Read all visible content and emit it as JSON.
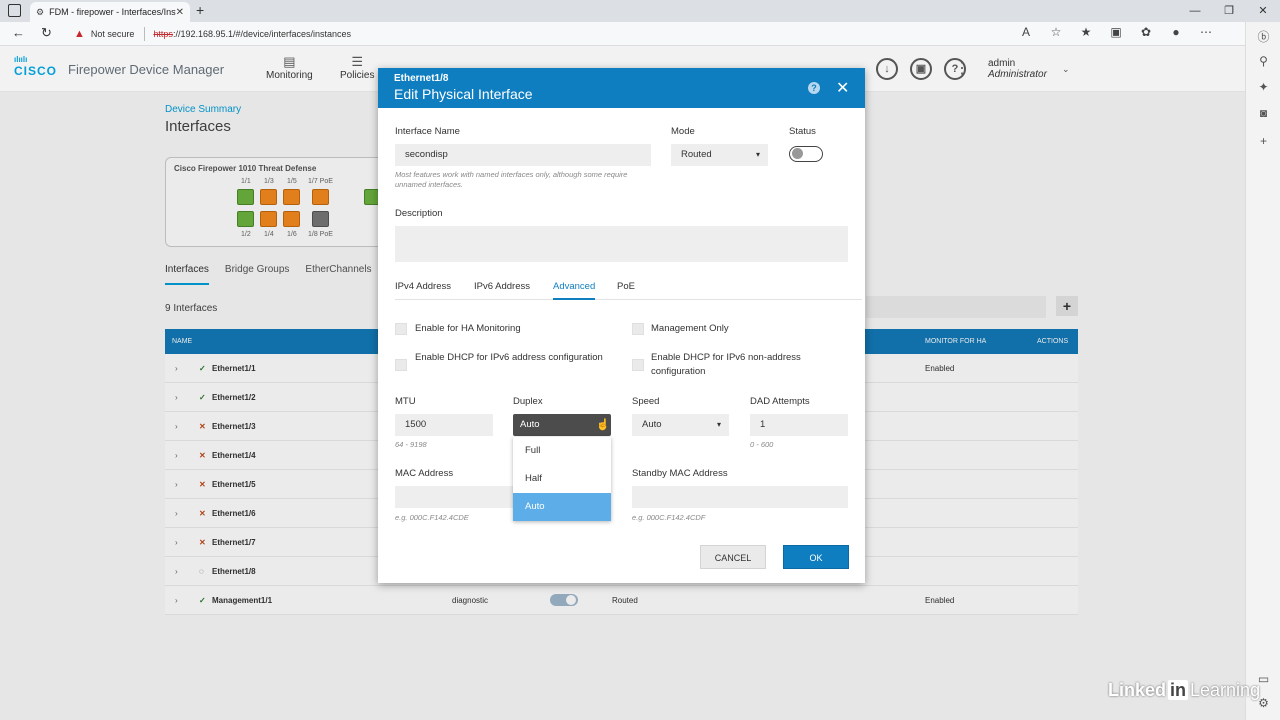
{
  "browser": {
    "tab_title": "FDM - firepower - Interfaces/Inst",
    "not_secure": "Not secure",
    "url_scheme": "https",
    "url_rest": "://192.168.95.1/#/device/interfaces/instances"
  },
  "app": {
    "brand": "CISCO",
    "title": "Firepower Device Manager",
    "nav": [
      {
        "label": "Monitoring",
        "icon": "monitor-icon"
      },
      {
        "label": "Policies",
        "icon": "policies-icon"
      }
    ],
    "user_name": "admin",
    "user_role": "Administrator"
  },
  "page": {
    "breadcrumb": "Device Summary",
    "title": "Interfaces",
    "device_name": "Cisco Firepower 1010 Threat Defense",
    "port_labels_top": [
      "1/1",
      "1/3",
      "1/5",
      "1/7 PoE"
    ],
    "port_labels_bottom": [
      "1/2",
      "1/4",
      "1/6",
      "1/8 PoE"
    ],
    "subtabs": [
      "Interfaces",
      "Bridge Groups",
      "EtherChannels"
    ],
    "count": "9 Interfaces",
    "table_headers": {
      "name": "NAME",
      "monitor": "MONITOR FOR HA",
      "actions": "ACTIONS"
    },
    "rows": [
      {
        "name": "Ethernet1/1",
        "status": "ok",
        "monitor": "Enabled"
      },
      {
        "name": "Ethernet1/2",
        "status": "ok",
        "monitor": ""
      },
      {
        "name": "Ethernet1/3",
        "status": "bad",
        "monitor": ""
      },
      {
        "name": "Ethernet1/4",
        "status": "bad",
        "monitor": ""
      },
      {
        "name": "Ethernet1/5",
        "status": "bad",
        "monitor": ""
      },
      {
        "name": "Ethernet1/6",
        "status": "bad",
        "monitor": ""
      },
      {
        "name": "Ethernet1/7",
        "status": "bad",
        "monitor": ""
      },
      {
        "name": "Ethernet1/8",
        "status": "mid",
        "monitor": ""
      },
      {
        "name": "Management1/1",
        "status": "ok",
        "logical": "diagnostic",
        "mode": "Routed",
        "monitor": "Enabled"
      }
    ]
  },
  "modal": {
    "subtitle": "Ethernet1/8",
    "title": "Edit Physical Interface",
    "interface_name_label": "Interface Name",
    "interface_name_value": "secondisp",
    "interface_name_hint": "Most features work with named interfaces only, although some require unnamed interfaces.",
    "mode_label": "Mode",
    "mode_value": "Routed",
    "status_label": "Status",
    "description_label": "Description",
    "tabs": [
      "IPv4 Address",
      "IPv6 Address",
      "Advanced",
      "PoE"
    ],
    "active_tab": "Advanced",
    "checkboxes": {
      "ha_monitoring": "Enable for HA Monitoring",
      "management_only": "Management Only",
      "dhcp_ipv6_address": "Enable DHCP for IPv6 address configuration",
      "dhcp_ipv6_nonaddress": "Enable DHCP for IPv6 non-address configuration"
    },
    "mtu_label": "MTU",
    "mtu_value": "1500",
    "mtu_hint": "64 - 9198",
    "duplex_label": "Duplex",
    "duplex_value": "Auto",
    "duplex_options": [
      "Full",
      "Half",
      "Auto"
    ],
    "speed_label": "Speed",
    "speed_value": "Auto",
    "dad_label": "DAD Attempts",
    "dad_value": "1",
    "dad_hint": "0 - 600",
    "mac_label": "MAC Address",
    "mac_hint": "e.g. 000C.F142.4CDE",
    "standby_mac_label": "Standby MAC Address",
    "standby_mac_hint": "e.g. 000C.F142.4CDF",
    "cancel_label": "CANCEL",
    "ok_label": "OK"
  },
  "watermark": {
    "pre": "Linked",
    "in": "in",
    "post": "Learning"
  },
  "colors": {
    "accent": "#0f7ec1",
    "cisco": "#049fd9",
    "selected": "#5dade8"
  }
}
